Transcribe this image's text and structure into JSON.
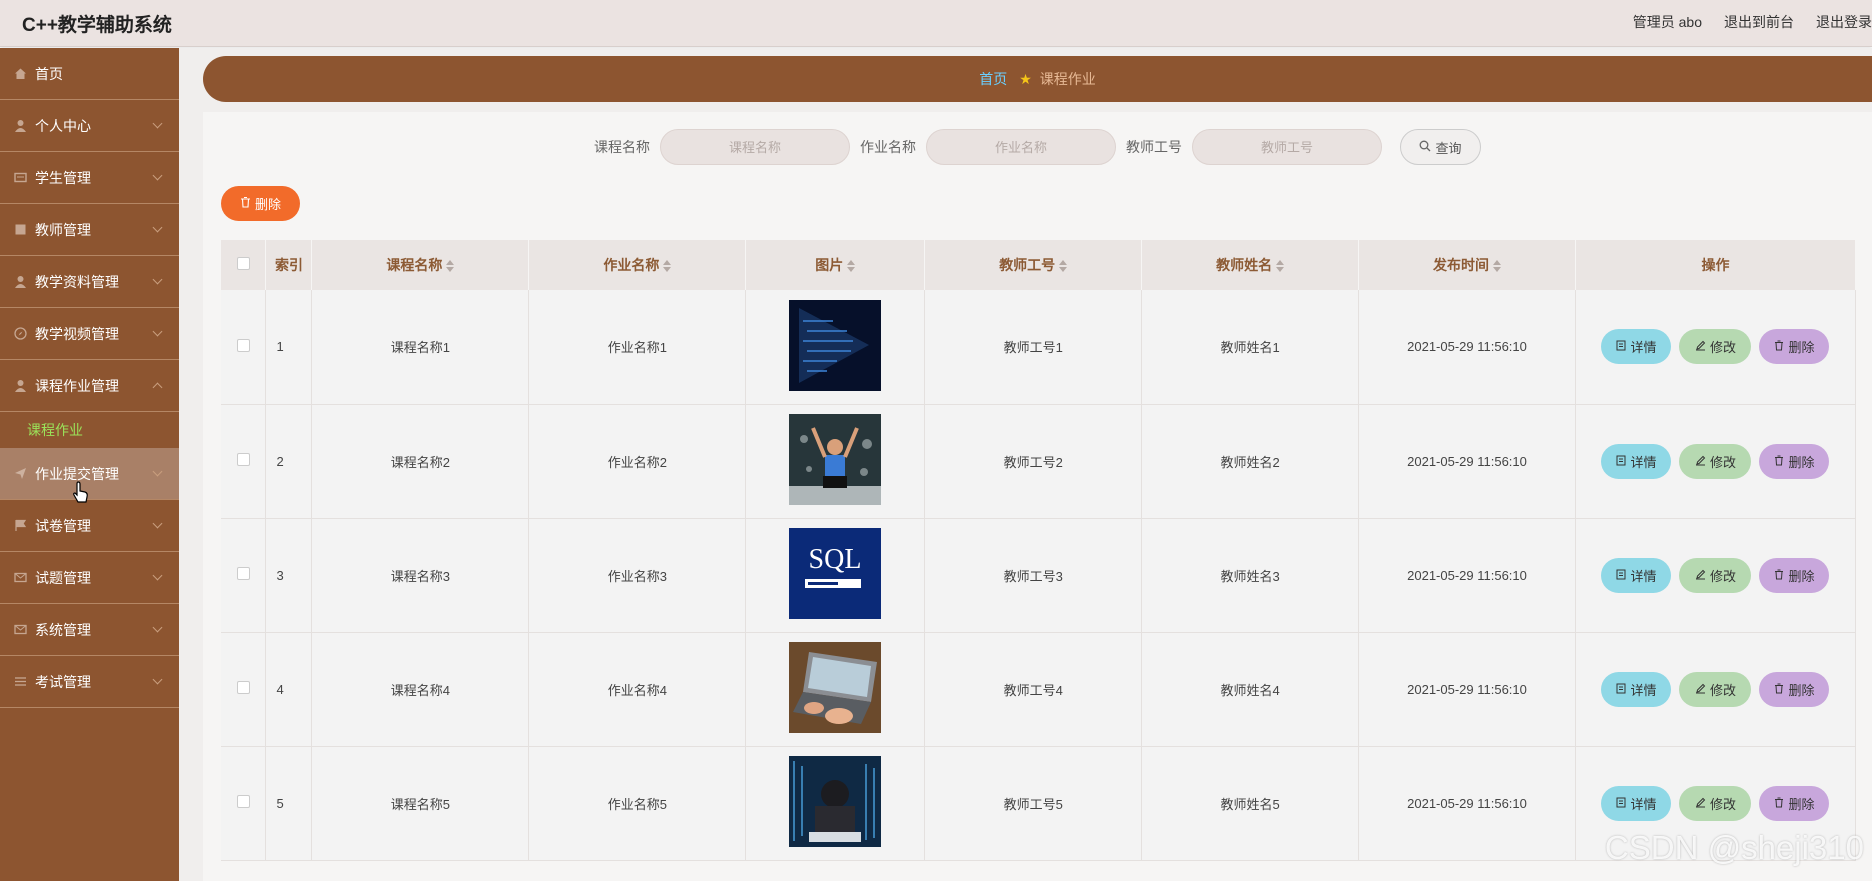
{
  "app_title": "C++教学辅助系统",
  "header_links": [
    "管理员 abo",
    "退出到前台",
    "退出登录"
  ],
  "sidebar": {
    "items": [
      {
        "label": "首页",
        "icon": "home-icon",
        "chevron": false
      },
      {
        "label": "个人中心",
        "icon": "user-icon",
        "chevron": true
      },
      {
        "label": "学生管理",
        "icon": "card-icon",
        "chevron": true
      },
      {
        "label": "教师管理",
        "icon": "book-icon",
        "chevron": true
      },
      {
        "label": "教学资料管理",
        "icon": "user-icon",
        "chevron": true
      },
      {
        "label": "教学视频管理",
        "icon": "compass-icon",
        "chevron": true
      },
      {
        "label": "课程作业管理",
        "icon": "user-icon",
        "chevron": true
      },
      {
        "label": "作业提交管理",
        "icon": "send-icon",
        "chevron": true
      },
      {
        "label": "试卷管理",
        "icon": "flag-icon",
        "chevron": true
      },
      {
        "label": "试题管理",
        "icon": "mail-icon",
        "chevron": true
      },
      {
        "label": "系统管理",
        "icon": "envelope-icon",
        "chevron": true
      },
      {
        "label": "考试管理",
        "icon": "sliders-icon",
        "chevron": true
      }
    ],
    "submenu_label": "课程作业"
  },
  "breadcrumb": {
    "home": "首页",
    "current": "课程作业"
  },
  "search": {
    "course_label": "课程名称",
    "course_placeholder": "课程名称",
    "homework_label": "作业名称",
    "homework_placeholder": "作业名称",
    "teacher_label": "教师工号",
    "teacher_placeholder": "教师工号",
    "button": "查询"
  },
  "bulk_delete_label": "删除",
  "table": {
    "headers": [
      "索引",
      "课程名称",
      "作业名称",
      "图片",
      "教师工号",
      "教师姓名",
      "发布时间",
      "操作"
    ],
    "rows": [
      {
        "index": "1",
        "course": "课程名称1",
        "homework": "作业名称1",
        "image": "code-art",
        "teacher_no": "教师工号1",
        "teacher_name": "教师姓名1",
        "time": "2021-05-29 11:56:10"
      },
      {
        "index": "2",
        "course": "课程名称2",
        "homework": "作业名称2",
        "image": "person-chalkboard",
        "teacher_no": "教师工号2",
        "teacher_name": "教师姓名2",
        "time": "2021-05-29 11:56:10"
      },
      {
        "index": "3",
        "course": "课程名称3",
        "homework": "作业名称3",
        "image": "sql-book",
        "teacher_no": "教师工号3",
        "teacher_name": "教师姓名3",
        "time": "2021-05-29 11:56:10"
      },
      {
        "index": "4",
        "course": "课程名称4",
        "homework": "作业名称4",
        "image": "laptop-typing",
        "teacher_no": "教师工号4",
        "teacher_name": "教师姓名4",
        "time": "2021-05-29 11:56:10"
      },
      {
        "index": "5",
        "course": "课程名称5",
        "homework": "作业名称5",
        "image": "hacker-screen",
        "teacher_no": "教师工号5",
        "teacher_name": "教师姓名5",
        "time": "2021-05-29 11:56:10"
      }
    ],
    "actions": {
      "detail": "详情",
      "edit": "修改",
      "delete": "删除"
    }
  },
  "watermark": "CSDN @sheji310",
  "colors": {
    "brand": "#8d5530",
    "accent_orange": "#f26b2a",
    "detail": "#8fd8e6",
    "edit": "#b6d9b1",
    "delete": "#c8a7dc"
  }
}
